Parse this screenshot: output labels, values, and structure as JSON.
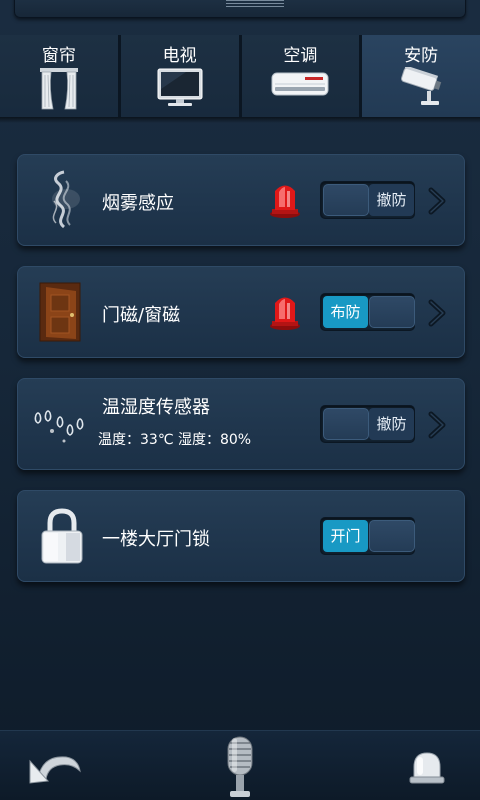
{
  "tabs": [
    {
      "label": "窗帘",
      "icon": "curtain-icon",
      "active": false
    },
    {
      "label": "电视",
      "icon": "tv-icon",
      "active": false
    },
    {
      "label": "空调",
      "icon": "air-conditioner-icon",
      "active": false
    },
    {
      "label": "安防",
      "icon": "security-camera-icon",
      "active": true
    }
  ],
  "devices": [
    {
      "name": "烟雾感应",
      "icon": "smoke-icon",
      "alarm": true,
      "switch_state": "off",
      "switch_label": "撤防",
      "has_detail": true
    },
    {
      "name": "门磁/窗磁",
      "icon": "door-icon",
      "alarm": true,
      "switch_state": "on",
      "switch_label": "布防",
      "has_detail": true
    },
    {
      "name": "温湿度传感器",
      "subtitle": "温度：33℃  湿度：80%",
      "icon": "water-drops-icon",
      "alarm": false,
      "switch_state": "off",
      "switch_label": "撤防",
      "has_detail": true
    },
    {
      "name": "一楼大厅门锁",
      "icon": "padlock-icon",
      "alarm": false,
      "switch_state": "on",
      "switch_label": "开门",
      "has_detail": false
    }
  ],
  "bottom": {
    "back_icon": "back-arrow-icon",
    "mic_icon": "microphone-icon",
    "alarm_icon": "alarm-bell-icon"
  },
  "colors": {
    "background": "#172a3d",
    "card": "#233a52",
    "switch_on": "#1899c4",
    "alarm_red": "#e01818"
  }
}
